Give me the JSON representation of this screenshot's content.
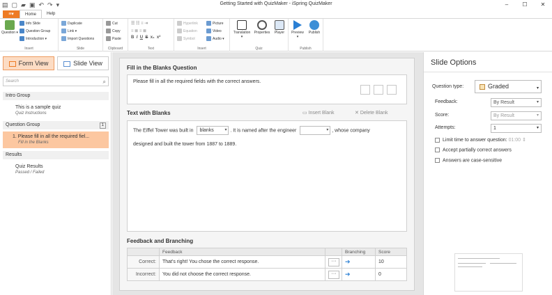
{
  "window": {
    "title": "Getting Started with QuizMaker - iSpring QuizMaker",
    "tabs": [
      "Home",
      "Help"
    ],
    "active_tab": "Home",
    "controls": [
      "–",
      "☐",
      "✕"
    ]
  },
  "ribbon": {
    "groups": {
      "insert": {
        "label": "Insert",
        "question": "Question",
        "info_slide": "Info Slide",
        "question_group": "Question Group",
        "introduction": "Introduction"
      },
      "slide": {
        "label": "Slide",
        "duplicate": "Duplicate",
        "link": "Link",
        "import_questions": "Import Questions"
      },
      "clipboard": {
        "label": "Clipboard",
        "cut": "Cut",
        "copy": "Copy",
        "paste": "Paste"
      },
      "text": {
        "label": "Text",
        "bold": "B",
        "italic": "I",
        "underline": "U",
        "strike": "S",
        "sub": "x₁",
        "sup": "x²"
      },
      "insert2": {
        "label": "Insert",
        "hyperlink": "Hyperlink",
        "equation": "Equation",
        "symbol": "Symbol",
        "picture": "Picture",
        "video": "Video",
        "audio": "Audio"
      },
      "quiz": {
        "label": "Quiz",
        "translation": "Translation",
        "properties": "Properties",
        "player": "Player"
      },
      "publish": {
        "label": "Publish",
        "preview": "Preview",
        "publish": "Publish"
      }
    }
  },
  "left": {
    "form_view": "Form View",
    "slide_view": "Slide View",
    "search_placeholder": "Search",
    "groups": [
      {
        "title": "Intro Group",
        "slides": [
          {
            "title": "This is a sample quiz",
            "sub": "Quiz Instructions"
          }
        ]
      },
      {
        "title": "Question Group",
        "count": "1",
        "slides": [
          {
            "title": "1.  Please fill in all the required fiel...",
            "sub": "Fill in the Blanks"
          }
        ]
      },
      {
        "title": "Results",
        "slides": [
          {
            "title": "Quiz Results",
            "sub": "Passed / Failed"
          }
        ]
      }
    ]
  },
  "center": {
    "question_header": "Fill in the Blanks Question",
    "question_text": "Please fill in all the required fields with the correct answers.",
    "text_header": "Text with Blanks",
    "insert_blank": "Insert Blank",
    "delete_blank": "Delete Blank",
    "blank_text": {
      "part1": "The Eiffel Tower was built in",
      "blank1": "blanks",
      "part2": ".  It is named after the engineer",
      "blank2": "",
      "part3": ", whose company",
      "line2": "designed and built the tower from 1887 to 1889."
    },
    "feedback_header": "Feedback and Branching",
    "table": {
      "headers": [
        "",
        "Feedback",
        "",
        "Branching",
        "Score"
      ],
      "rows": [
        {
          "label": "Correct:",
          "feedback": "That's right! You chose the correct response.",
          "score": "10"
        },
        {
          "label": "Incorrect:",
          "feedback": "You did not choose the correct response.",
          "score": "0"
        }
      ]
    }
  },
  "right": {
    "title": "Slide Options",
    "question_type_label": "Question type:",
    "question_type": "Graded",
    "feedback_label": "Feedback:",
    "feedback_value": "By Result",
    "score_label": "Score:",
    "score_value": "By Result",
    "attempts_label": "Attempts:",
    "attempts_value": "1",
    "limit_time": "Limit time to answer question:",
    "limit_time_value": "01:00",
    "accept_partial": "Accept partially correct answers",
    "case_sensitive": "Answers are case-sensitive"
  },
  "colors": {
    "accent": "#ee7b24",
    "selected": "#fcc7a0",
    "link_arrow": "#2a7fd4"
  }
}
